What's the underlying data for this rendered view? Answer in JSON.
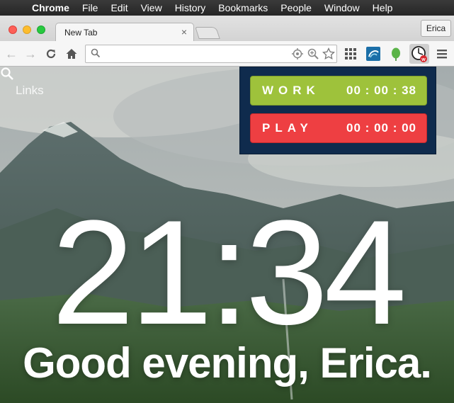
{
  "menubar": {
    "items": [
      "Chrome",
      "File",
      "Edit",
      "View",
      "History",
      "Bookmarks",
      "People",
      "Window",
      "Help"
    ]
  },
  "tabs": [
    {
      "title": "New Tab",
      "close": "×"
    }
  ],
  "profile": {
    "name": "Erica"
  },
  "toolbar": {
    "url_value": "",
    "icons": [
      "back-arrow-icon",
      "forward-arrow-icon",
      "reload-icon",
      "home-icon",
      "search-icon",
      "location-icon",
      "zoom-icon",
      "star-icon",
      "apps-grid-icon",
      "extension-icon",
      "evernote-icon",
      "timer-extension-icon",
      "menu-icon"
    ]
  },
  "page": {
    "links_label": "Links",
    "clock": "21:34",
    "greeting": "Good evening, Erica."
  },
  "popup": {
    "work": {
      "label": "WORK",
      "time": "00 : 00 : 38",
      "color": "#9ec23b"
    },
    "play": {
      "label": "PLAY",
      "time": "00 : 00 : 00",
      "color": "#ee3f42"
    },
    "background": "#0f2b4d"
  }
}
